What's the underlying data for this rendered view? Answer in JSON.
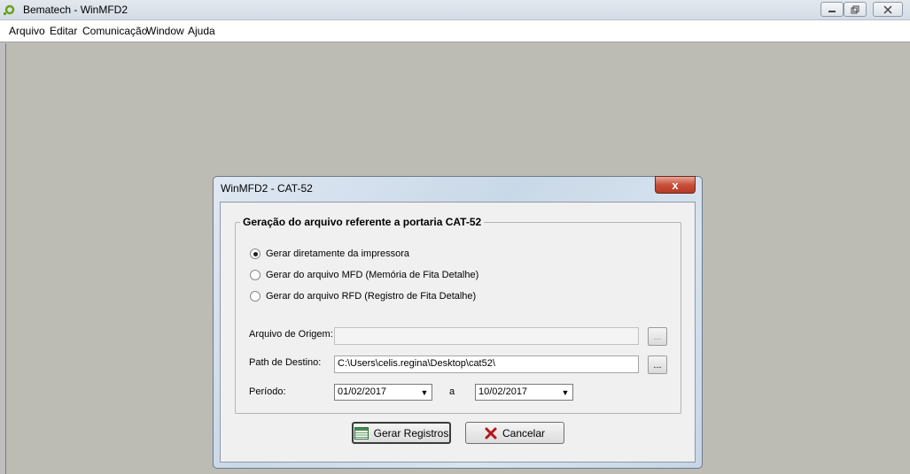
{
  "window": {
    "title": "Bematech - WinMFD2"
  },
  "menu": {
    "items": [
      {
        "label": "Arquivo"
      },
      {
        "label": "Editar"
      },
      {
        "label": "Comunicação"
      },
      {
        "label": "Window"
      },
      {
        "label": "Ajuda"
      }
    ]
  },
  "dialog": {
    "title": "WinMFD2 - CAT-52",
    "close_glyph": "x",
    "group_title": "Geração do arquivo referente a portaria CAT-52",
    "options": [
      {
        "label": "Gerar diretamente da impressora",
        "selected": true
      },
      {
        "label": "Gerar do arquivo MFD (Memória de Fita Detalhe)",
        "selected": false
      },
      {
        "label": "Gerar do arquivo RFD (Registro de Fita Detalhe)",
        "selected": false
      }
    ],
    "origem_label": "Arquivo de Origem:",
    "origem_value": "",
    "destino_label": "Path de Destino:",
    "destino_value": "C:\\Users\\celis.regina\\Desktop\\cat52\\",
    "browse_label": "...",
    "periodo_label": "Período:",
    "periodo_from": "01/02/2017",
    "periodo_sep": "a",
    "periodo_to": "10/02/2017",
    "gerar_button": "Gerar Registros",
    "cancelar_button": "Cancelar"
  }
}
